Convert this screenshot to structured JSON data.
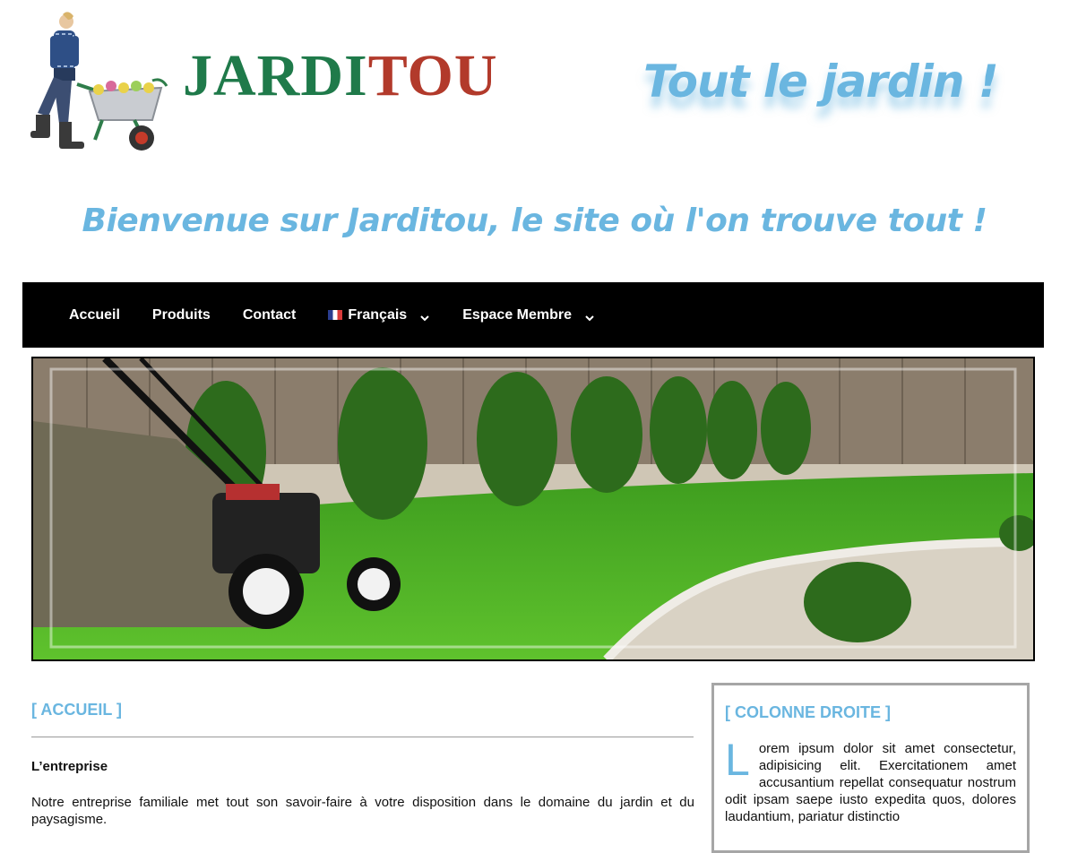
{
  "header": {
    "brand_part1": "JARDI",
    "brand_part2": "TOU",
    "tagline": "Tout le jardin !",
    "welcome": "Bienvenue sur Jarditou, le site où l'on trouve tout !"
  },
  "nav": {
    "items": [
      {
        "label": "Accueil"
      },
      {
        "label": "Produits"
      },
      {
        "label": "Contact"
      },
      {
        "label": "Français"
      },
      {
        "label": "Espace Membre"
      }
    ]
  },
  "main": {
    "title": "[ ACCUEIL ]",
    "subhead": "L’entreprise",
    "paragraph": "Notre entreprise familiale met tout son savoir-faire à votre disposition dans le domaine du jardin et du paysagisme."
  },
  "sidebar": {
    "title": "[ COLONNE DROITE ]",
    "dropcap": "L",
    "text": "orem ipsum dolor sit amet consectetur, adipisicing elit. Exercitationem amet accusantium repellat consequatur nostrum odit ipsam saepe iusto expedita quos, dolores laudantium, pariatur distinctio"
  },
  "colors": {
    "accent": "#6ab6e0",
    "brand_green": "#1f7a4a",
    "brand_red": "#b23a2b",
    "nav_bg": "#000000"
  }
}
